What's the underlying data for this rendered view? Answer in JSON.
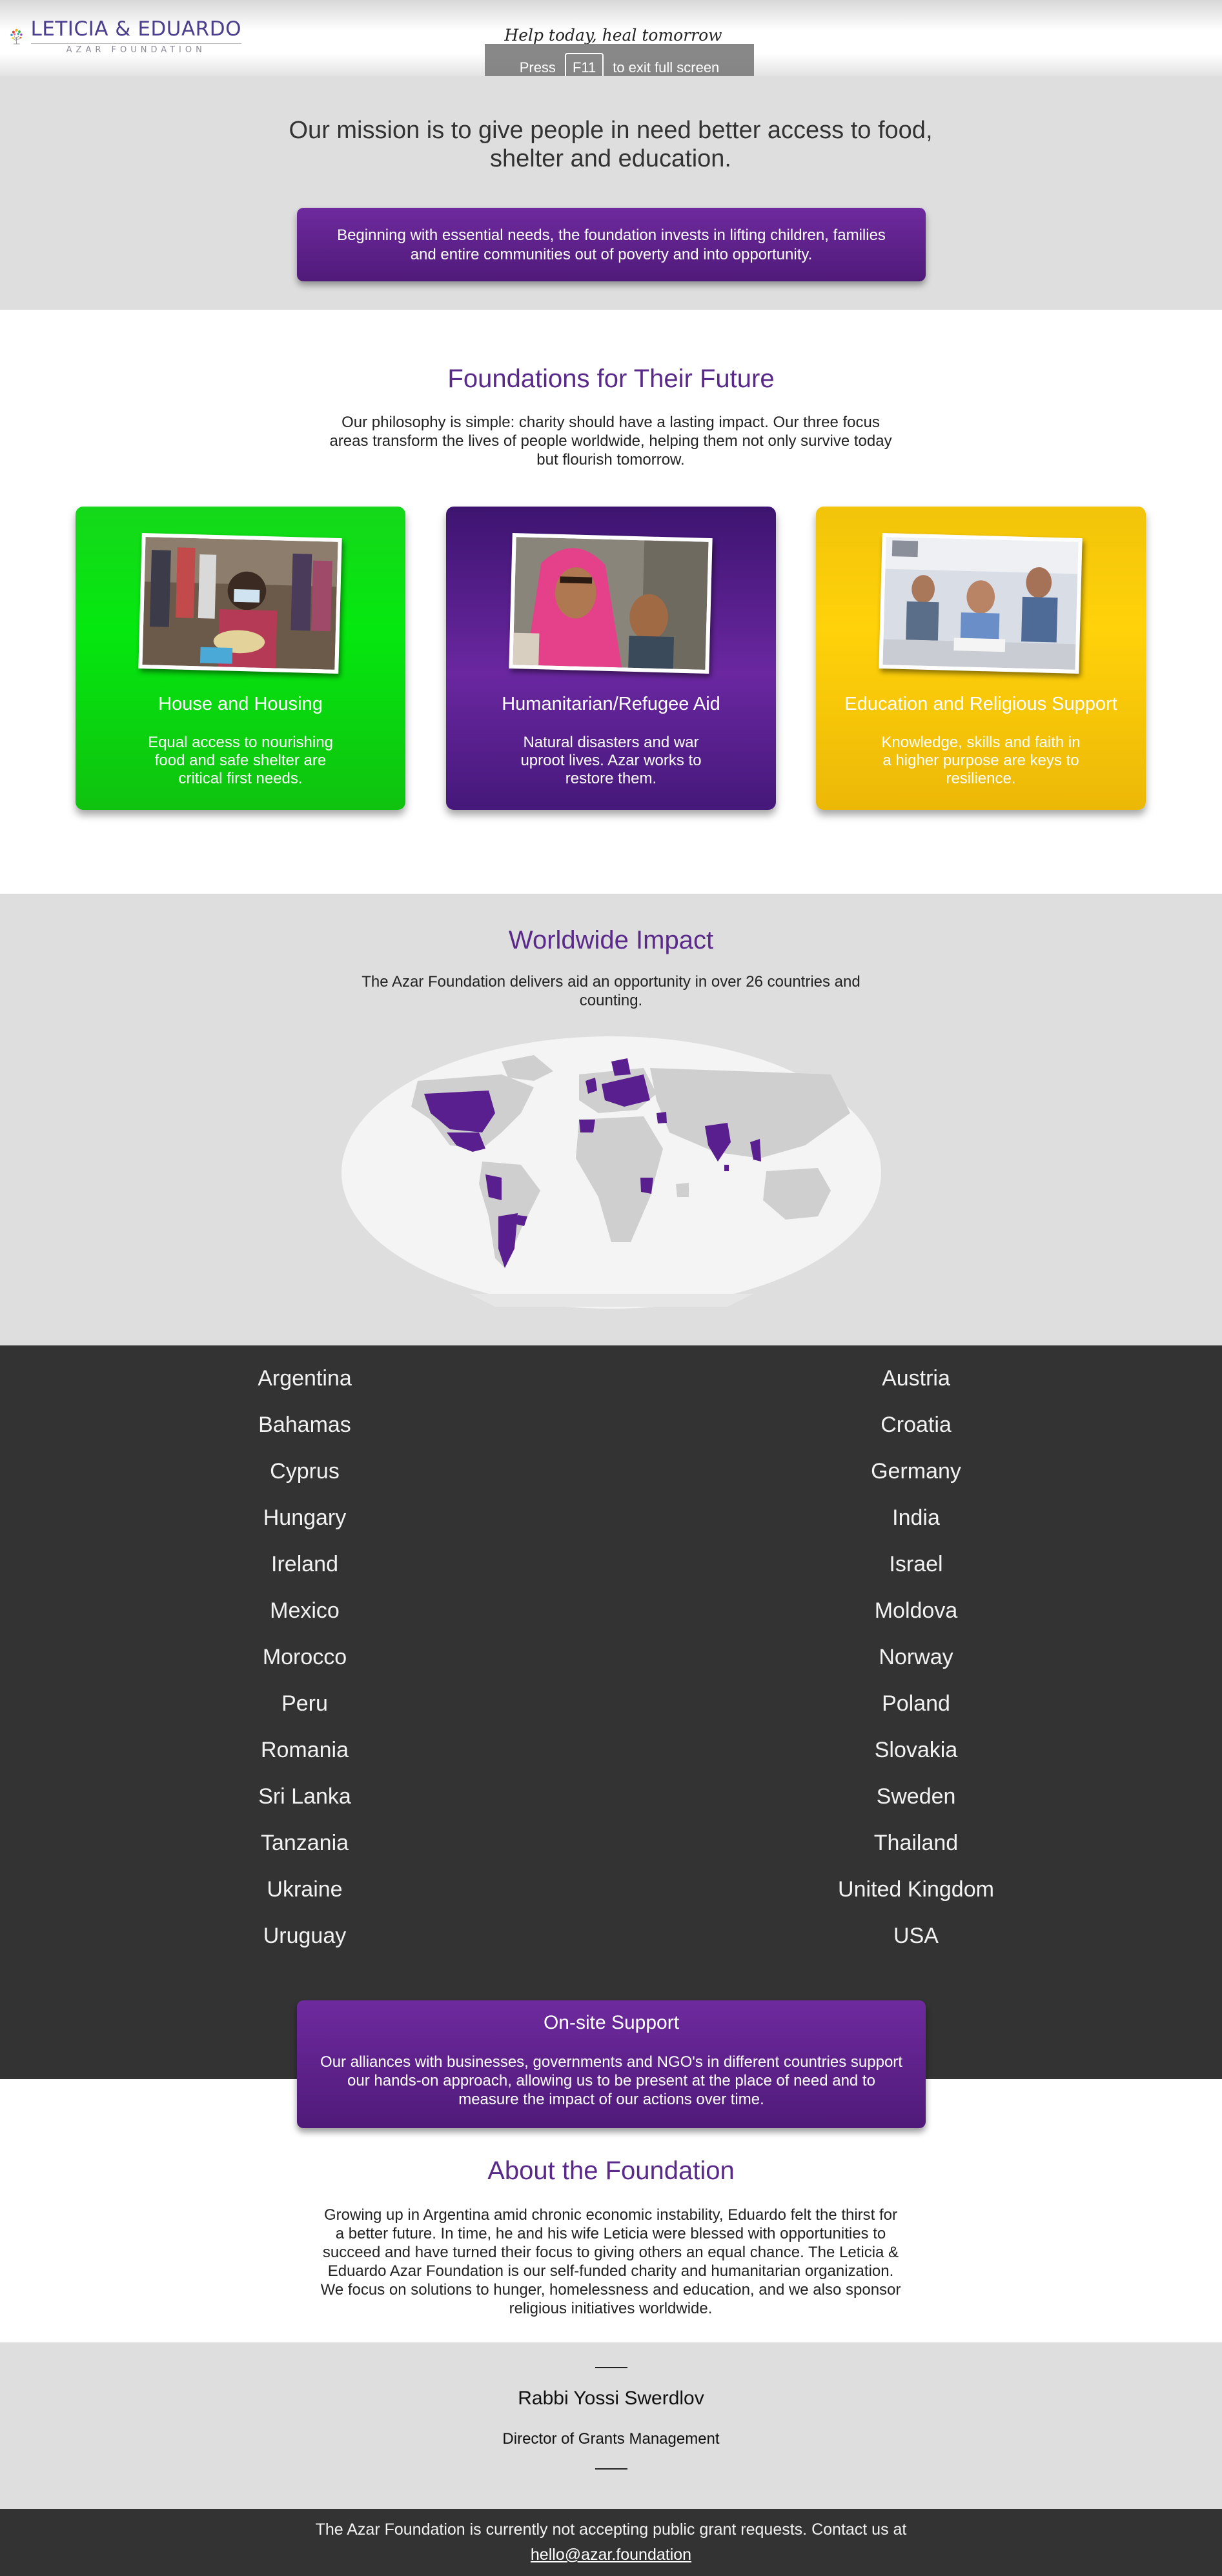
{
  "header": {
    "logo_name": "LETICIA & EDUARDO",
    "logo_sub": "AZAR FOUNDATION",
    "tagline": "Help today, heal tomorrow"
  },
  "fullscreen_notice": {
    "prefix": "Press",
    "key": "F11",
    "suffix": "to exit full screen"
  },
  "mission": {
    "headline": "Our mission is to give people in need better access to food, shelter and education.",
    "box_text": "Beginning with essential needs, the foundation invests in lifting children, families and entire communities out of poverty and into opportunity."
  },
  "foundations": {
    "title": "Foundations for Their Future",
    "description": "Our philosophy is simple: charity should have a lasting impact. Our three focus areas transform the lives of people worldwide, helping them not only survive today but flourish tomorrow.",
    "cards": [
      {
        "title": "House and Housing",
        "description": "Equal access to nourishing food and safe shelter are critical first needs.",
        "color": "#0ad60f"
      },
      {
        "title": "Humanitarian/Refugee Aid",
        "description": "Natural disasters and war uproot lives. Azar works to restore them.",
        "color": "#5a1f8e"
      },
      {
        "title": "Education and Religious Support",
        "description": "Knowledge, skills and faith in a higher purpose are keys to resilience.",
        "color": "#fccb0a"
      }
    ]
  },
  "worldwide": {
    "title": "Worldwide Impact",
    "description": "The Azar Foundation delivers aid an opportunity in over 26 countries and counting."
  },
  "countries": {
    "left": [
      "Argentina",
      "Bahamas",
      "Cyprus",
      "Hungary",
      "Ireland",
      "Mexico",
      "Morocco",
      "Peru",
      "Romania",
      "Sri Lanka",
      "Tanzania",
      "Ukraine",
      "Uruguay"
    ],
    "right": [
      "Austria",
      "Croatia",
      "Germany",
      "India",
      "Israel",
      "Moldova",
      "Norway",
      "Poland",
      "Slovakia",
      "Sweden",
      "Thailand",
      "United Kingdom",
      "USA"
    ]
  },
  "support": {
    "title": "On-site Support",
    "description": "Our alliances with businesses, governments and NGO's in different countries support our hands-on approach, allowing us to be present at the place of need and to measure the impact of our actions over time."
  },
  "about": {
    "title": "About the Foundation",
    "description": "Growing up in Argentina amid chronic economic instability, Eduardo felt the thirst for a better future. In time, he and his wife Leticia were blessed with opportunities to succeed and have turned their focus to giving others an equal chance. The Leticia & Eduardo Azar Foundation is our self-funded charity and humanitarian organization. We focus on solutions to hunger, homelessness and education, and we also sponsor religious initiatives worldwide."
  },
  "contact": {
    "name": "Rabbi Yossi Swerdlov",
    "role": "Director of Grants Management"
  },
  "footer": {
    "text": "The Azar Foundation is currently not accepting public grant requests. Contact us at",
    "email": "hello@azar.foundation"
  },
  "colors": {
    "accent_purple": "#5a2a8a",
    "highlight_purple": "#5a1f8e",
    "dark_band": "#333333",
    "light_band": "#dedede"
  }
}
